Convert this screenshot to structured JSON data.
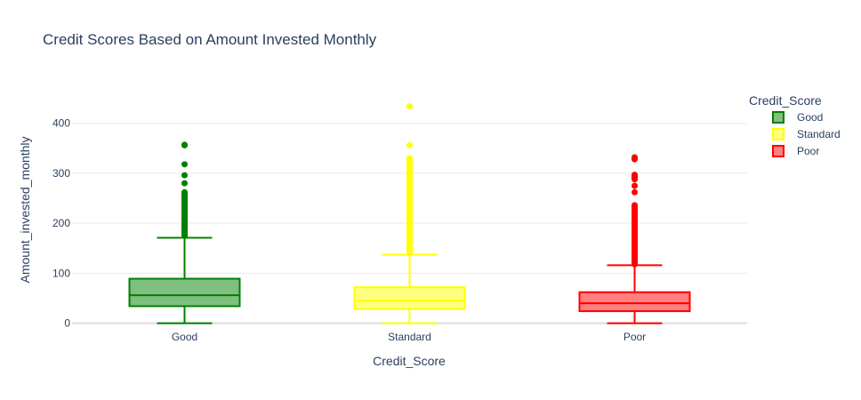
{
  "chart_data": {
    "type": "box",
    "title": "Credit Scores Based on Amount Invested Monthly",
    "xlabel": "Credit_Score",
    "ylabel": "Amount_invested_monthly",
    "ylim": [
      -15,
      460
    ],
    "yticks": [
      0,
      100,
      200,
      300,
      400
    ],
    "categories": [
      "Good",
      "Standard",
      "Poor"
    ],
    "legend": {
      "title": "Credit_Score",
      "position": "top-right"
    },
    "series": [
      {
        "name": "Good",
        "color": "#008000",
        "fill": "rgba(0,128,0,0.5)",
        "min": 0,
        "q1": 34,
        "median": 56,
        "q3": 89,
        "upper_fence": 171,
        "outliers": [
          175,
          180,
          185,
          190,
          195,
          200,
          205,
          210,
          215,
          220,
          228,
          235,
          245,
          255,
          262,
          280,
          296,
          318,
          356,
          357
        ]
      },
      {
        "name": "Standard",
        "color": "#ffff00",
        "fill": "rgba(255,255,0,0.5)",
        "min": 0,
        "q1": 28,
        "median": 45,
        "q3": 72,
        "upper_fence": 137,
        "outliers": [
          140,
          150,
          160,
          170,
          180,
          190,
          200,
          210,
          220,
          230,
          240,
          250,
          260,
          270,
          280,
          290,
          298,
          310,
          320,
          330,
          356,
          434
        ]
      },
      {
        "name": "Poor",
        "color": "#ff0000",
        "fill": "rgba(255,0,0,0.5)",
        "min": 0,
        "q1": 24,
        "median": 40,
        "q3": 62,
        "upper_fence": 116,
        "outliers": [
          118,
          125,
          135,
          145,
          155,
          165,
          175,
          185,
          195,
          205,
          215,
          225,
          236,
          262,
          275,
          288,
          297,
          328,
          332
        ]
      }
    ]
  }
}
